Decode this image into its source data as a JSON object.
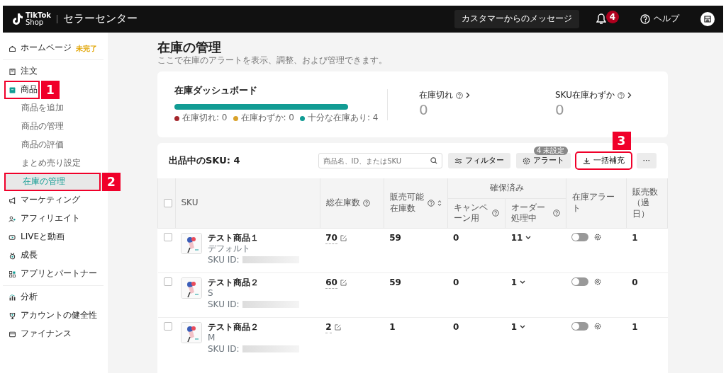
{
  "header": {
    "logo_line1": "TikTok",
    "logo_line2": "Shop",
    "title": "セラーセンター",
    "message_button": "カスタマーからのメッセージ",
    "notification_count": "4",
    "help": "ヘルプ"
  },
  "sidebar": {
    "groups": [
      {
        "items": [
          {
            "label": "ホームページ",
            "tag": "未完了",
            "selected": false
          }
        ]
      },
      {
        "items": [
          {
            "label": "注文",
            "selected": false
          },
          {
            "label": "商品",
            "selected": false,
            "callout": "1",
            "children": [
              {
                "label": "商品を追加",
                "selected": false
              },
              {
                "label": "商品の管理",
                "selected": false
              },
              {
                "label": "商品の評価",
                "selected": false
              },
              {
                "label": "まとめ売り設定",
                "selected": false
              },
              {
                "label": "在庫の管理",
                "selected": true,
                "callout": "2"
              }
            ]
          },
          {
            "label": "マーケティング",
            "selected": false
          },
          {
            "label": "アフィリエイト",
            "selected": false
          },
          {
            "label": "LIVEと動画",
            "selected": false
          },
          {
            "label": "成長",
            "selected": false
          },
          {
            "label": "アプリとパートナー",
            "selected": false
          }
        ]
      },
      {
        "items": [
          {
            "label": "分析",
            "selected": false
          },
          {
            "label": "アカウントの健全性",
            "selected": false
          },
          {
            "label": "ファイナンス",
            "selected": false
          }
        ]
      }
    ]
  },
  "page": {
    "title": "在庫の管理",
    "subtitle": "ここで在庫のアラートを表示、調整、および管理できます。"
  },
  "dashboard": {
    "title": "在庫ダッシュボード",
    "level": 1,
    "legend": [
      {
        "label": "在庫切れ: 0",
        "color": "#a4262c"
      },
      {
        "label": "在庫わずか: 0",
        "color": "#d9a22b"
      },
      {
        "label": "十分な在庫あり: 4",
        "color": "#129c94"
      }
    ],
    "stats": [
      {
        "label": "在庫切れ",
        "value": "0"
      },
      {
        "label": "SKU在庫わずか",
        "value": "0"
      }
    ]
  },
  "sku_panel": {
    "title": "出品中のSKU: 4",
    "search": {
      "placeholder": "商品名、ID、またはSKU"
    },
    "buttons": [
      {
        "kind": "filter",
        "label": "フィルター"
      },
      {
        "kind": "alert",
        "label": "アラート",
        "badge": "4 未設定"
      },
      {
        "kind": "download",
        "label": "一括補充",
        "callout": "3"
      },
      {
        "kind": "more",
        "label": "···"
      }
    ],
    "table": {
      "select_all_checked": false,
      "columns": [
        {
          "label": "SKU",
          "help": false,
          "sort": false
        },
        {
          "label": "総在庫数",
          "help": true,
          "sort": false
        },
        {
          "label": "販売可能在庫数",
          "help": true,
          "sort": true
        },
        {
          "label": "確保済み",
          "columns": [
            {
              "label": "キャンペーン用",
              "help": true,
              "sort": false
            },
            {
              "label": "オーダー処理中",
              "help": true,
              "sort": false
            }
          ]
        },
        {
          "label": "在庫アラート",
          "help": false,
          "sort": false
        },
        {
          "label": "販売数（過日）",
          "help": false,
          "sort": false
        }
      ],
      "rows": [
        {
          "checked": false,
          "name": "テスト商品１",
          "variant": "デフォルト",
          "sku_label": "SKU ID:",
          "total": "70",
          "available": "59",
          "campaign": "0",
          "processing": "11",
          "alert_on": false,
          "sales": "1"
        },
        {
          "checked": false,
          "name": "テスト商品２",
          "variant": "S",
          "sku_label": "SKU ID:",
          "total": "60",
          "available": "59",
          "campaign": "0",
          "processing": "1",
          "alert_on": false,
          "sales": "0"
        },
        {
          "checked": false,
          "name": "テスト商品２",
          "variant": "M",
          "sku_label": "SKU ID:",
          "total": "2",
          "available": "1",
          "campaign": "0",
          "processing": "1",
          "alert_on": false,
          "sales": "1"
        }
      ]
    }
  }
}
